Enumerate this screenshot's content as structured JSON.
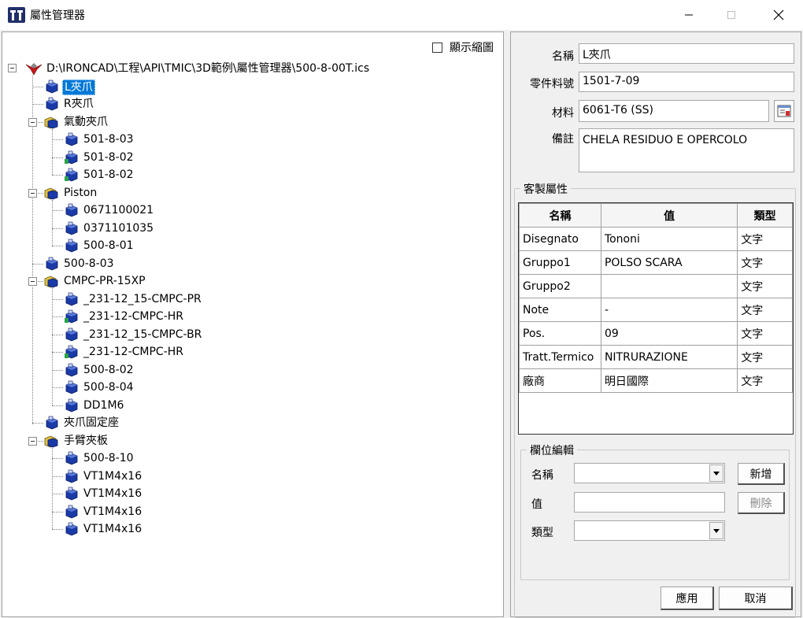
{
  "window": {
    "title": "屬性管理器"
  },
  "tree": {
    "show_thumbnail_label": "顯示縮圖",
    "root": "D:\\IRONCAD\\工程\\API\\TMIC\\3D範例\\屬性管理器\\500-8-00T.ics",
    "items": [
      {
        "label": "L夾爪",
        "kind": "part",
        "selected": true
      },
      {
        "label": "R夾爪",
        "kind": "part"
      },
      {
        "label": "氣動夾爪",
        "kind": "assembly"
      },
      {
        "label": "501-8-03",
        "kind": "part"
      },
      {
        "label": "501-8-02",
        "kind": "part-green"
      },
      {
        "label": "501-8-02",
        "kind": "part-green"
      },
      {
        "label": "Piston",
        "kind": "assembly"
      },
      {
        "label": "0671100021",
        "kind": "part"
      },
      {
        "label": "0371101035",
        "kind": "part"
      },
      {
        "label": "500-8-01",
        "kind": "part"
      },
      {
        "label": "500-8-03",
        "kind": "part"
      },
      {
        "label": "CMPC-PR-15XP",
        "kind": "assembly"
      },
      {
        "label": "_231-12_15-CMPC-PR",
        "kind": "part"
      },
      {
        "label": "_231-12-CMPC-HR",
        "kind": "part-green"
      },
      {
        "label": "_231-12_15-CMPC-BR",
        "kind": "part"
      },
      {
        "label": "_231-12-CMPC-HR",
        "kind": "part-green"
      },
      {
        "label": "500-8-02",
        "kind": "part"
      },
      {
        "label": "500-8-04",
        "kind": "part"
      },
      {
        "label": "DD1M6",
        "kind": "part"
      },
      {
        "label": "夾爪固定座",
        "kind": "part"
      },
      {
        "label": "手臂夾板",
        "kind": "assembly"
      },
      {
        "label": "500-8-10",
        "kind": "part"
      },
      {
        "label": "VT1M4x16",
        "kind": "part"
      },
      {
        "label": "VT1M4x16",
        "kind": "part"
      },
      {
        "label": "VT1M4x16",
        "kind": "part"
      },
      {
        "label": "VT1M4x16",
        "kind": "part"
      }
    ]
  },
  "props": {
    "name_label": "名稱",
    "name_value": "L夾爪",
    "partno_label": "零件料號",
    "partno_value": "1501-7-09",
    "material_label": "材料",
    "material_value": "6061-T6 (SS)",
    "note_label": "備註",
    "note_value": "CHELA RESIDUO E OPERCOLO"
  },
  "custom": {
    "group_title": "客製屬性",
    "headers": [
      "名稱",
      "值",
      "類型"
    ],
    "rows": [
      [
        "Disegnato",
        "Tononi",
        "文字"
      ],
      [
        "Gruppo1",
        "POLSO SCARA",
        "文字"
      ],
      [
        "Gruppo2",
        "",
        "文字"
      ],
      [
        "Note",
        "-",
        "文字"
      ],
      [
        "Pos.",
        "09",
        "文字"
      ],
      [
        "Tratt.Termico",
        "NITRURAZIONE",
        "文字"
      ],
      [
        "廠商",
        "明日國際",
        "文字"
      ]
    ]
  },
  "editor": {
    "group_title": "欄位編輯",
    "name_label": "名稱",
    "value_label": "值",
    "type_label": "類型",
    "add_button": "新增",
    "delete_button": "刪除"
  },
  "footer": {
    "apply_button": "應用",
    "cancel_button": "取消"
  },
  "colors": {
    "selection": "#0078d7",
    "part_icon": "#1a3aa8",
    "assembly_icon": "#e0c040",
    "root_icon": "#c81818"
  }
}
